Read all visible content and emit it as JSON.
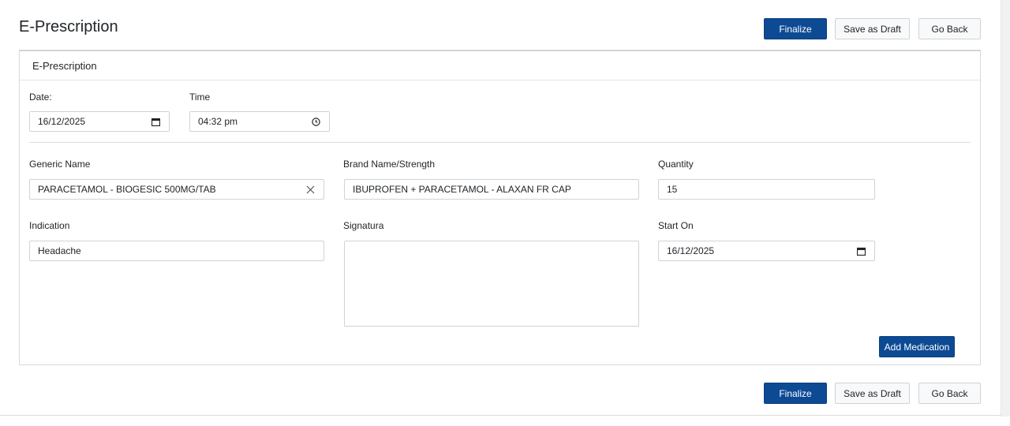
{
  "header": {
    "title": "E-Prescription",
    "finalize_label": "Finalize",
    "save_draft_label": "Save as Draft",
    "go_back_label": "Go Back"
  },
  "card": {
    "title": "E-Prescription",
    "date_label": "Date:",
    "date_value": "16/12/2025",
    "time_label": "Time",
    "time_value": "04:32 pm",
    "generic_name_label": "Generic Name",
    "generic_name_value": "PARACETAMOL - BIOGESIC 500MG/TAB",
    "brand_label": "Brand Name/Strength",
    "brand_value": "IBUPROFEN + PARACETAMOL - ALAXAN FR CAP",
    "quantity_label": "Quantity",
    "quantity_value": "15",
    "indication_label": "Indication",
    "indication_value": "Headache",
    "signatura_label": "Signatura",
    "signatura_value": "",
    "start_on_label": "Start On",
    "start_on_value": "16/12/2025",
    "add_medication_label": "Add Medication"
  },
  "footer": {
    "finalize_label": "Finalize",
    "save_draft_label": "Save as Draft",
    "go_back_label": "Go Back"
  },
  "icons": {
    "calendar": "calendar-icon",
    "clock": "clock-icon",
    "clear": "clear-icon"
  },
  "colors": {
    "primary": "#0d4a94"
  }
}
